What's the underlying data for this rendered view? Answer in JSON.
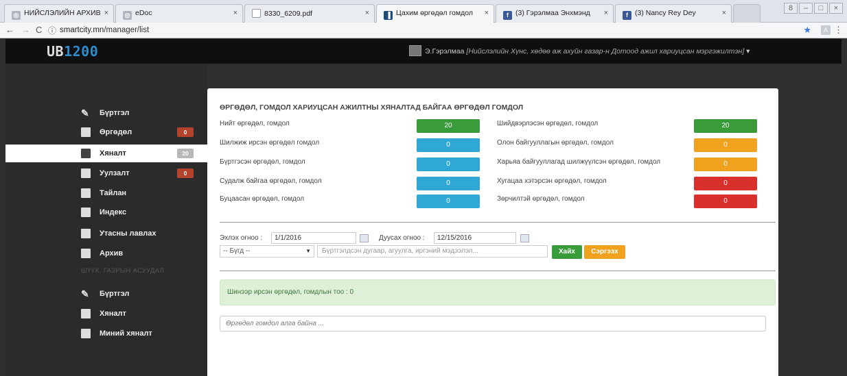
{
  "browser": {
    "tabs": [
      {
        "title": "НИЙСЛЭЛИЙН АРХИВ",
        "icon": "globe-icon"
      },
      {
        "title": "eDoc",
        "icon": "globe-icon"
      },
      {
        "title": "8330_6209.pdf",
        "icon": "document-icon"
      },
      {
        "title": "Цахим өргөдөл гомдол",
        "icon": "chart-icon"
      },
      {
        "title": "(3) Гэрэлмаа Энхмэнд",
        "icon": "facebook-icon"
      },
      {
        "title": "(3) Nancy Rey Dey",
        "icon": "facebook-icon"
      }
    ],
    "url_host": "smartcity.mn",
    "url_path": "/manager/list",
    "ext_label": "A"
  },
  "header": {
    "logo_prefix": "UB",
    "logo_number": "1200",
    "user_name": "Э.Гэрэлмаа",
    "user_role": "[Нийслэлийн Хүнс, хөдөө аж ахуйн газар-н Дотоод ажил хариуцсан мэргэжилтэн]"
  },
  "sidebar": {
    "items": [
      {
        "label": "Бүртгэл",
        "badge": ""
      },
      {
        "label": "Өргөдөл",
        "badge": "0"
      },
      {
        "label": "Хяналт",
        "badge": "20"
      },
      {
        "label": "Уулзалт",
        "badge": "0"
      },
      {
        "label": "Тайлан",
        "badge": ""
      },
      {
        "label": "Индекс",
        "badge": ""
      },
      {
        "label": "Утасны лавлах",
        "badge": ""
      },
      {
        "label": "Архив",
        "badge": ""
      }
    ],
    "section2_heading": "ШҮҮХ, ГАЗРЫН АСУУДАЛ",
    "items2": [
      {
        "label": "Бүртгэл"
      },
      {
        "label": "Хяналт"
      },
      {
        "label": "Миний хяналт"
      }
    ]
  },
  "panel": {
    "title": "ӨРГӨДӨЛ, ГОМДОЛ ХАРИУЦСАН АЖИЛТНЫ ХЯНАЛТАД БАЙГАА ӨРГӨДӨЛ ГОМДОЛ",
    "stats_left": [
      {
        "label": "Нийт өргөдөл, гомдол",
        "value": "20",
        "color": "#3a9b3a"
      },
      {
        "label": "Шилжиж ирсэн өргөдөл гомдол",
        "value": "0",
        "color": "#2fa8d5"
      },
      {
        "label": "Бүртгэсэн өргөдөл, гомдол",
        "value": "0",
        "color": "#2fa8d5"
      },
      {
        "label": "Судалж байгаа өргөдөл, гомдол",
        "value": "0",
        "color": "#2fa8d5"
      },
      {
        "label": "Буцаасан өргөдөл, гомдол",
        "value": "0",
        "color": "#2fa8d5"
      }
    ],
    "stats_right": [
      {
        "label": "Шийдвэрлэсэн өргөдөл, гомдол",
        "value": "20",
        "color": "#3a9b3a"
      },
      {
        "label": "Олон байгууллагын өргөдөл, гомдол",
        "value": "0",
        "color": "#f0a21e"
      },
      {
        "label": "Харьяа байгууллагад шилжүүлсэн өргөдөл, гомдол",
        "value": "0",
        "color": "#f0a21e"
      },
      {
        "label": "Хугацаа хэтэрсэн өргөдөл, гомдол",
        "value": "0",
        "color": "#d9302c"
      },
      {
        "label": "Зөрчилтэй өргөдөл, гомдол",
        "value": "0",
        "color": "#d9302c"
      }
    ],
    "filter": {
      "start_label": "Эхлэх огноо :",
      "start_value": "1/1/2016",
      "end_label": "Дуусах огноо :",
      "end_value": "12/15/2016",
      "type_value": "-- Бүгд --",
      "search_placeholder": "Бүртгэлдсэн дугаар, агуулга, иргэний мэдээлэл...",
      "search_button": "Хайх",
      "reset_button": "Сэргээх"
    },
    "info_text": "Шинээр ирсэн өргөдөл, гомдлын тоо : 0",
    "empty_text": "Өргөдөл гомдол алга байна ..."
  }
}
